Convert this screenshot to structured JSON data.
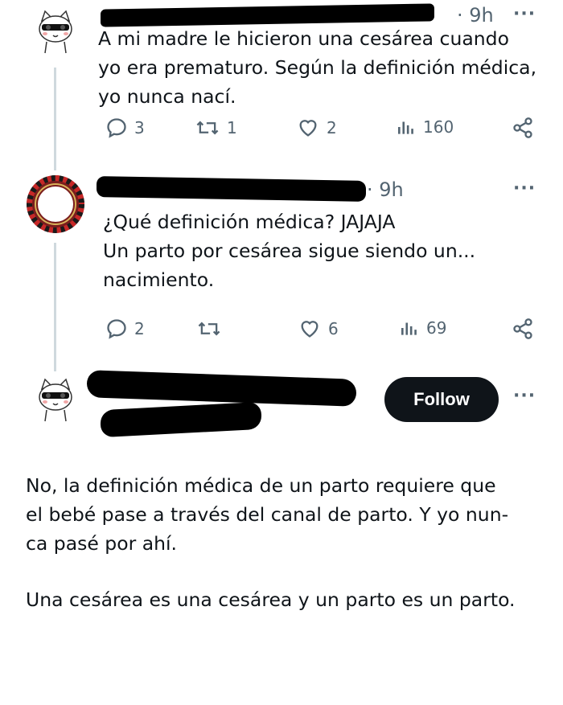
{
  "tweets": [
    {
      "time": "· 9h",
      "text": "A mi madre le hicieron una cesárea cuando\nyo era prematuro. Según la definición médica,\nyo nunca nací.",
      "replies": "3",
      "retweets": "1",
      "likes": "2",
      "views": "160",
      "avatar": "cartoon-cat-avatar"
    },
    {
      "time": "· 9h",
      "text": "¿Qué definición médica? JAJAJA\nUn parto por cesárea sigue siendo un...\nnacimiento.",
      "replies": "2",
      "retweets": "",
      "likes": "6",
      "views": "69",
      "avatar": "roulette-wheel-avatar"
    }
  ],
  "third": {
    "follow_label": "Follow",
    "avatar": "cartoon-cat-avatar",
    "paragraph1": "No, la definición médica de un parto requiere que el bebé pase a través del canal de parto. Y yo nun-ca pasé por ahí.",
    "paragraph1_lines": [
      "No, la definición médica de un parto requiere que",
      "el bebé pase a través del canal de parto. Y yo nun-",
      "ca pasé por ahí."
    ],
    "paragraph2": "Una cesárea es una cesárea y un parto es un parto."
  },
  "more_label": "···"
}
